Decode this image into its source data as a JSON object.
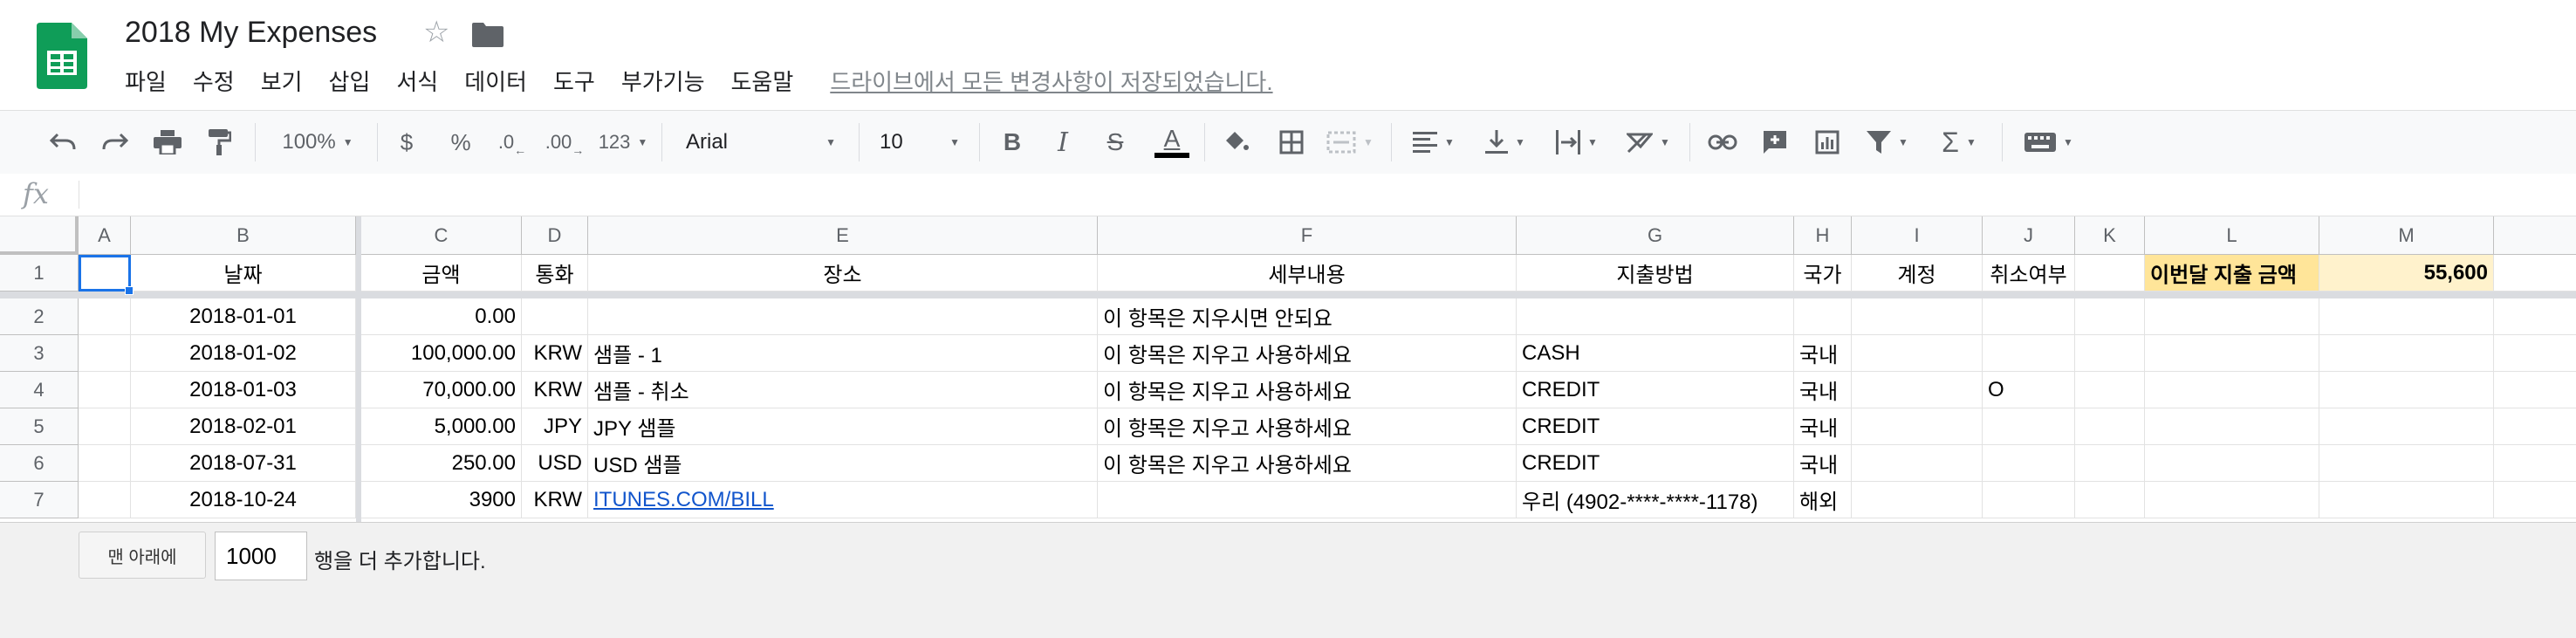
{
  "doc": {
    "title": "2018 My Expenses",
    "icons": {
      "logo": "sheets-logo",
      "star": "star-icon",
      "folder": "folder-icon"
    }
  },
  "menu": {
    "items": [
      "파일",
      "수정",
      "보기",
      "삽입",
      "서식",
      "데이터",
      "도구",
      "부가기능",
      "도움말"
    ],
    "save_status": "드라이브에서 모든 변경사항이 저장되었습니다."
  },
  "toolbar": {
    "zoom": "100%",
    "currency": "$",
    "percent": "%",
    "decimal_decrease": ".0",
    "decimal_increase": ".00",
    "format_more": "123",
    "font": "Arial",
    "font_size": "10",
    "bold": "B",
    "italic": "I",
    "strike": "S",
    "text_color": "A",
    "text_color_value": "#000000"
  },
  "formula_bar": {
    "label": "fx",
    "value": ""
  },
  "sheet": {
    "columns": [
      "A",
      "B",
      "C",
      "D",
      "E",
      "F",
      "G",
      "H",
      "I",
      "J",
      "K",
      "L",
      "M"
    ],
    "rows": [
      {
        "n": "1",
        "cells": [
          "",
          "날짜",
          "금액",
          "통화",
          "장소",
          "세부내용",
          "지출방법",
          "국가",
          "계정",
          "취소여부",
          "",
          "이번달 지출 금액",
          "55,600"
        ]
      },
      {
        "n": "2",
        "cells": [
          "",
          "2018-01-01",
          "0.00",
          "",
          "",
          "이 항목은 지우시면 안되요",
          "",
          "",
          "",
          "",
          "",
          "",
          ""
        ]
      },
      {
        "n": "3",
        "cells": [
          "",
          "2018-01-02",
          "100,000.00",
          "KRW",
          "샘플 - 1",
          "이 항목은 지우고 사용하세요",
          "CASH",
          "국내",
          "",
          "",
          "",
          "",
          ""
        ]
      },
      {
        "n": "4",
        "cells": [
          "",
          "2018-01-03",
          "70,000.00",
          "KRW",
          "샘플 - 취소",
          "이 항목은 지우고 사용하세요",
          "CREDIT",
          "국내",
          "",
          "O",
          "",
          "",
          ""
        ]
      },
      {
        "n": "5",
        "cells": [
          "",
          "2018-02-01",
          "5,000.00",
          "JPY",
          "JPY 샘플",
          "이 항목은 지우고 사용하세요",
          "CREDIT",
          "국내",
          "",
          "",
          "",
          "",
          ""
        ]
      },
      {
        "n": "6",
        "cells": [
          "",
          "2018-07-31",
          "250.00",
          "USD",
          "USD 샘플",
          "이 항목은 지우고 사용하세요",
          "CREDIT",
          "국내",
          "",
          "",
          "",
          "",
          ""
        ]
      },
      {
        "n": "7",
        "cells": [
          "",
          "2018-10-24",
          "3900",
          "KRW",
          "ITUNES.COM/BILL",
          "",
          "우리 (4902-****-****-1178)",
          "해외",
          "",
          "",
          "",
          "",
          ""
        ]
      }
    ],
    "highlight_colors": {
      "label": "#ffe599",
      "value": "#fff2cc"
    },
    "selected_cell": "A1"
  },
  "footer": {
    "add_button": "맨 아래에",
    "row_count": "1000",
    "add_text": "행을 더 추가합니다."
  }
}
